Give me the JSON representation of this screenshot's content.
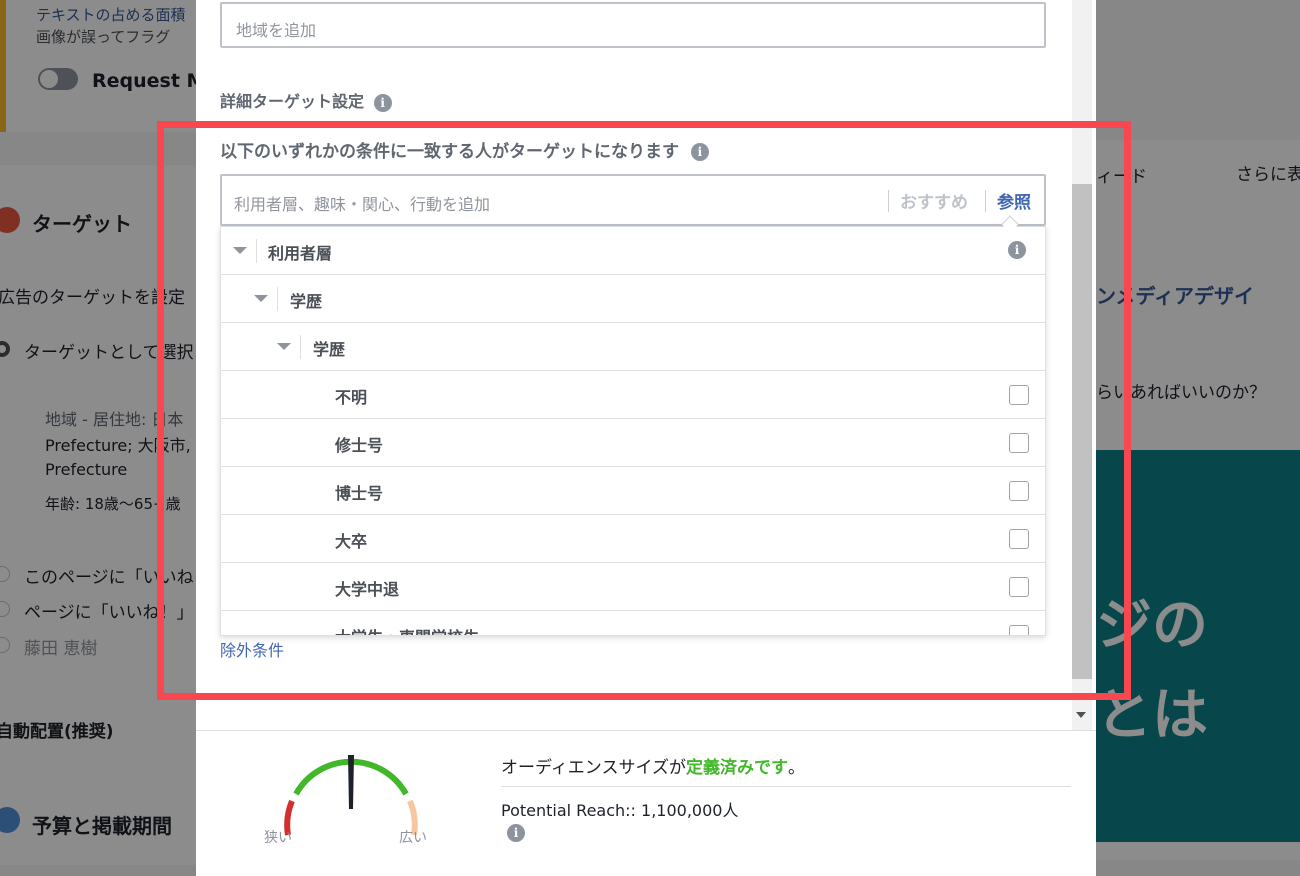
{
  "background": {
    "warning_line1": "テキストの占める面積",
    "warning_line2": "画像が誤ってフラグ",
    "request_toggle_label": "Request Ma",
    "section_target_title": "ターゲット",
    "target_desc": "広告のターゲットを設定",
    "target_option": "ターゲットとして選択",
    "location_line1": "地域 - 居住地: 日本",
    "location_line2": "Prefecture; 大阪市,",
    "location_line3": "Prefecture",
    "age_line": "年齢: 18歳〜65+歳",
    "option_like_page": "このページに「いいね",
    "option_page_like": "ページに「いいね！」",
    "option_custom": "藤田 恵樹",
    "auto_placement": "自動配置(推奨)",
    "section_budget_title": "予算と掲載期間",
    "right_nav1": "ィード",
    "right_nav2": "さらに表",
    "right_article_title": "ンメディアデザイ",
    "right_article_sub": "らいあればいいのか？",
    "right_image_text1": "ジの",
    "right_image_text2": "とは"
  },
  "modal": {
    "region_placeholder": "地域を追加",
    "detailed_targeting_label": "詳細ターゲット設定",
    "match_condition_label": "以下のいずれかの条件に一致する人がターゲットになります",
    "targeting_placeholder": "利用者層、趣味・関心、行動を追加",
    "suggestions_label": "おすすめ",
    "browse_label": "参照",
    "tree": {
      "level1": "利用者層",
      "level2": "学歴",
      "level3": "学歴",
      "items": [
        "不明",
        "修士号",
        "博士号",
        "大卒",
        "大学中退",
        "大学生・専門学校生"
      ]
    },
    "exclude_link": "除外条件"
  },
  "footer": {
    "gauge_narrow": "狭い",
    "gauge_wide": "広い",
    "audience_prefix": "オーディエンスサイズが",
    "audience_defined": "定義済みです",
    "audience_suffix": "。",
    "potential_reach": "Potential Reach:: 1,100,000人"
  },
  "icons": {
    "info": "info-icon",
    "collapse": "triangle-down-icon",
    "checkbox": "checkbox-icon"
  },
  "colors": {
    "highlight_frame": "#f9474f",
    "link_blue": "#4267b2",
    "defined_green": "#42b72a",
    "gauge_green": "#42b72a",
    "gauge_red": "#d32f2f",
    "gauge_peach": "#f5c6a0"
  }
}
